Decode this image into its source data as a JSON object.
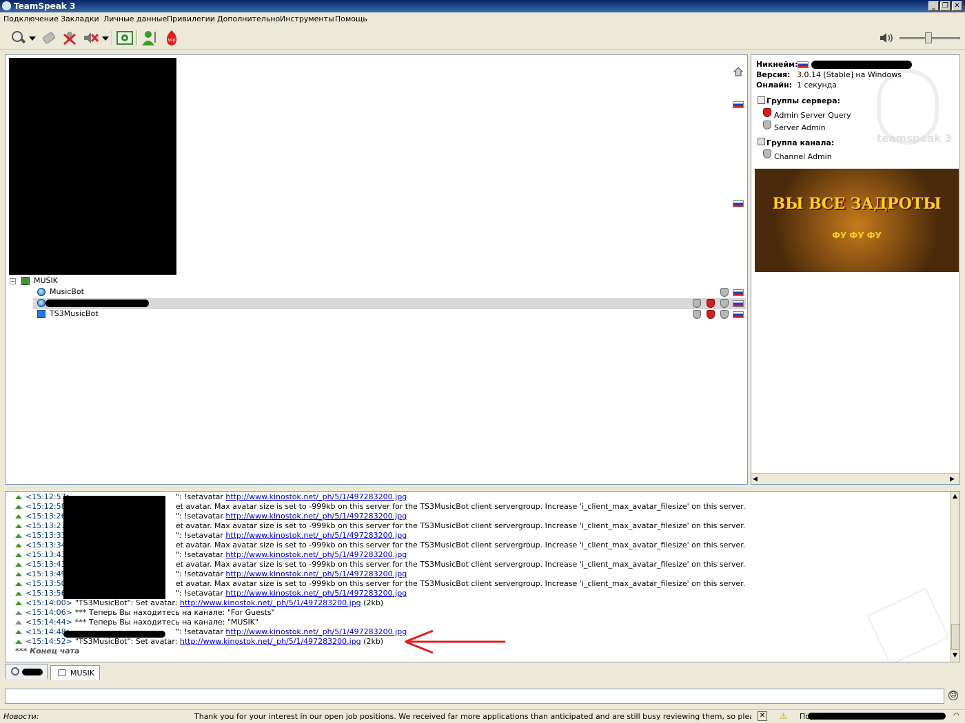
{
  "window": {
    "title": "TeamSpeak 3"
  },
  "menu": [
    "Подключение",
    "Закладки",
    "Личные данные",
    "Привилегии",
    "Дополнительно",
    "Инструменты",
    "Помощь"
  ],
  "tree": {
    "channel_name": "MUSIK",
    "clients": [
      {
        "name": "MusicBot"
      },
      {
        "name": ""
      },
      {
        "name": "TS3MusicBot"
      }
    ]
  },
  "info": {
    "nickname_label": "Никнейм:",
    "version_label": "Версия:",
    "version_value": "3.0.14 [Stable] на Windows",
    "online_label": "Онлайн:",
    "online_value": "1 секунда",
    "server_groups_label": "Группы сервера:",
    "server_groups": [
      "Admin Server Query",
      "Server Admin"
    ],
    "channel_group_label": "Группа канала:",
    "channel_groups": [
      "Channel Admin"
    ],
    "watermark": "teamspeak 3",
    "banner_text": "ВЫ ВСЕ ЗАДРОТЫ",
    "banner_sub": "ФУ ФУ ФУ"
  },
  "chat": {
    "lines": [
      {
        "ts": "<15:12:57>",
        "text": "\": !setavatar ",
        "link": "http://www.kinostok.net/_ph/5/1/497283200.jpg"
      },
      {
        "ts": "<15:12:58>",
        "text": "et avatar. Max avatar size is set to -999kb on this server for the TS3MusicBot client servergroup. Increase 'i_client_max_avatar_filesize' on this server.",
        "link": ""
      },
      {
        "ts": "<15:13:26>",
        "text": "\": !setavatar ",
        "link": "http://www.kinostok.net/_ph/5/1/497283200.jpg"
      },
      {
        "ts": "<15:13:27>",
        "text": "et avatar. Max avatar size is set to -999kb on this server for the TS3MusicBot client servergroup. Increase 'i_client_max_avatar_filesize' on this server.",
        "link": ""
      },
      {
        "ts": "<15:13:33>",
        "text": "\": !setavatar ",
        "link": "http://www.kinostok.net/_ph/5/1/497283200.jpg"
      },
      {
        "ts": "<15:13:34>",
        "text": "et avatar. Max avatar size is set to -999kb on this server for the TS3MusicBot client servergroup. Increase 'i_client_max_avatar_filesize' on this server.",
        "link": ""
      },
      {
        "ts": "<15:13:43>",
        "text": "\": !setavatar ",
        "link": "http://www.kinostok.net/_ph/5/1/497283200.jpg"
      },
      {
        "ts": "<15:13:43>",
        "text": "et avatar. Max avatar size is set to -999kb on this server for the TS3MusicBot client servergroup. Increase 'i_client_max_avatar_filesize' on this server.",
        "link": ""
      },
      {
        "ts": "<15:13:49>",
        "text": "\": !setavatar ",
        "link": "http://www.kinostok.net/_ph/5/1/497283200.jpg"
      },
      {
        "ts": "<15:13:50>",
        "text": "et avatar. Max avatar size is set to -999kb on this server for the TS3MusicBot client servergroup. Increase 'i_client_max_avatar_filesize' on this server.",
        "link": ""
      },
      {
        "ts": "<15:13:56>",
        "text": "\": !setavatar ",
        "link": "http://www.kinostok.net/_ph/5/1/497283200.jpg"
      },
      {
        "ts": "<15:14:00>",
        "text": "\"TS3MusicBot\": Set avatar: ",
        "link": "http://www.kinostok.net/_ph/5/1/497283200.jpg",
        "suffix": " (2kb)"
      },
      {
        "ts": "<15:14:06>",
        "text": "*** Теперь Вы находитесь на канале: \"For Guests\"",
        "link": ""
      },
      {
        "ts": "<15:14:44>",
        "text": "*** Теперь Вы находитесь на канале: \"MUSIK\"",
        "link": ""
      },
      {
        "ts": "<15:14:48>",
        "text": "\": !setavatar ",
        "link": "http://www.kinostok.net/_ph/5/1/497283200.jpg"
      },
      {
        "ts": "<15:14:52>",
        "text": "\"TS3MusicBot\": Set avatar: ",
        "link": "http://www.kinostok.net/_ph/5/1/497283200.jpg",
        "suffix": " (2kb)"
      }
    ],
    "end_text": "*** Конец чата"
  },
  "tabs": {
    "channel_tab": "MUSIK"
  },
  "status": {
    "news_label": "Новости:",
    "news_text": "Thank you for your interest in our open job positions. We received far more applications than anticipated and are still busy reviewing them, so please be patient if you ha",
    "right_text": "Подключен к"
  }
}
